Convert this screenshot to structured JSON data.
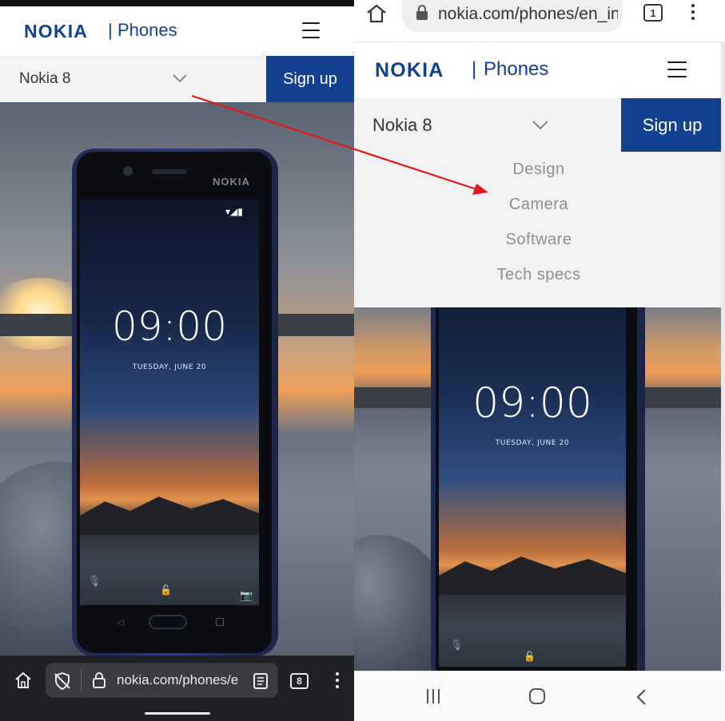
{
  "left": {
    "brand": "NOKIA",
    "separator": "|",
    "section": "Phones",
    "model": "Nokia 8",
    "signup": "Sign up",
    "phone_brand": "NOKIA",
    "clock": "09:00",
    "date": "TUESDAY, JUNE 20",
    "url": "nokia.com/phones/e",
    "tab_count": "8"
  },
  "right": {
    "url": "nokia.com/phones/en_in",
    "tab_count": "1",
    "brand": "NOKIA",
    "separator": "|",
    "section": "Phones",
    "model": "Nokia 8",
    "signup": "Sign up",
    "menu_items": [
      "Design",
      "Camera",
      "Software",
      "Tech specs"
    ],
    "clock": "09:00",
    "date": "TUESDAY, JUNE 20"
  },
  "colors": {
    "nokia_blue": "#124191",
    "annotation_arrow": "#e0191e"
  }
}
